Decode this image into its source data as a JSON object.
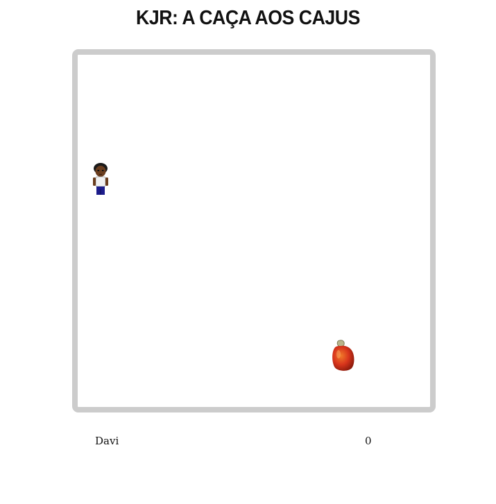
{
  "title": "KJR: A CAÇA AOS CAJUS",
  "player": {
    "name": "Davi",
    "score": "0",
    "sprite": "boy-character-icon"
  },
  "collectible": {
    "sprite": "cashew-fruit-icon"
  },
  "colors": {
    "board_border": "#cccccc",
    "board_background": "#ffffff",
    "cashew_red": "#d8351c"
  }
}
